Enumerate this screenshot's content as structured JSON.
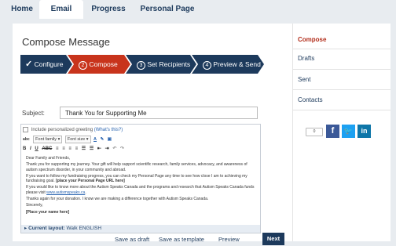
{
  "nav": {
    "tabs": [
      {
        "label": "Home"
      },
      {
        "label": "Email"
      },
      {
        "label": "Progress"
      },
      {
        "label": "Personal Page"
      }
    ]
  },
  "compose": {
    "title": "Compose Message",
    "steps": [
      {
        "label": "Configure",
        "marker": "✓"
      },
      {
        "label": "Compose",
        "marker": "2"
      },
      {
        "label": "Set Recipients",
        "marker": "3"
      },
      {
        "label": "Preview & Send",
        "marker": "4"
      }
    ],
    "subject_label": "Subject:",
    "subject_value": "Thank You for Supporting Me",
    "personalized_label": "Include personalized greeting",
    "whats_this": "(What's this?)",
    "font_family_label": "Font family",
    "font_size_label": "Font size",
    "body": {
      "greeting": "Dear Family and Friends,",
      "p1": "Thank you for supporting my journey. Your gift will help support scientific research, family services, advocacy, and awareness of autism spectrum disorder, in your community and abroad.",
      "p2_text": "If you want to follow my fundraising progress, you can check my Personal Page any time to see how close I am to achieving my fundraising goal.",
      "p2_bold": "[place your Personal Page URL here]",
      "p3_text": "If you would like to know more about the Autism Speaks Canada and the programs and research that Autism Speaks Canada funds please visit",
      "p3_link": "www.autismspeaks.ca",
      "p4": "Thanks again for your donation. I know we are making a difference together with Autism Speaks Canada.",
      "signoff": "Sincerely,",
      "name_placeholder": "[Place your name here]"
    },
    "layout_label": "Current layout:",
    "layout_value": "Walk ENGLISH"
  },
  "actions": {
    "save_draft": "Save as draft",
    "save_template": "Save as template",
    "preview": "Preview",
    "next": "Next"
  },
  "sidebar": {
    "items": [
      {
        "label": "Compose"
      },
      {
        "label": "Drafts"
      },
      {
        "label": "Sent"
      },
      {
        "label": "Contacts"
      }
    ],
    "share_count": "0"
  },
  "colors": {
    "nav_dark": "#1d3a5c",
    "step_active": "#c8341c",
    "step_inactive": "#1d3a5c",
    "sidebar_active": "#b22d1a",
    "facebook": "#3b5998",
    "twitter": "#1da1f2",
    "linkedin": "#0e76a8"
  }
}
